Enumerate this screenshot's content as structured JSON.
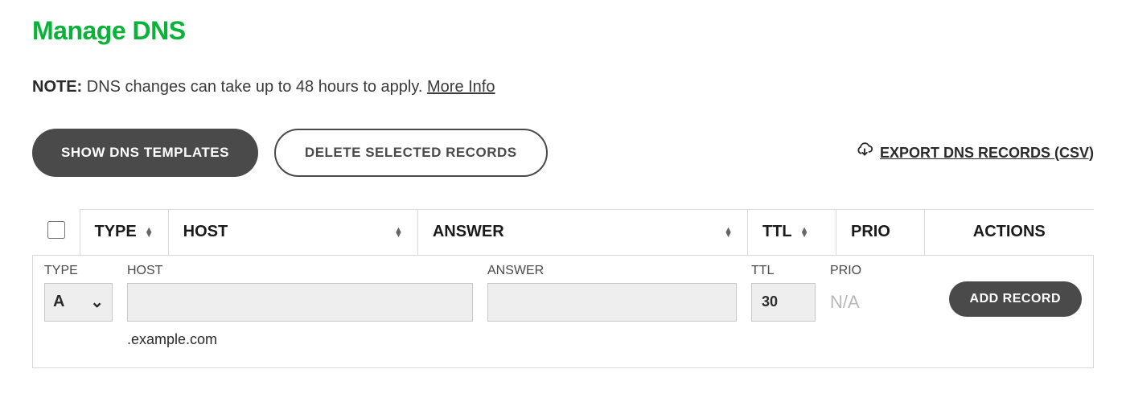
{
  "title": "Manage DNS",
  "note": {
    "label": "NOTE:",
    "text": " DNS changes can take up to 48 hours to apply. ",
    "link": "More Info"
  },
  "buttons": {
    "show_templates": "SHOW DNS TEMPLATES",
    "delete_selected": "DELETE SELECTED RECORDS",
    "export": "EXPORT DNS RECORDS (CSV)",
    "add_record": "ADD RECORD"
  },
  "columns": {
    "type": "TYPE",
    "host": "HOST",
    "answer": "ANSWER",
    "ttl": "TTL",
    "prio": "PRIO",
    "actions": "ACTIONS"
  },
  "entry": {
    "labels": {
      "type": "TYPE",
      "host": "HOST",
      "answer": "ANSWER",
      "ttl": "TTL",
      "prio": "PRIO"
    },
    "type_value": "A",
    "host_value": "",
    "host_suffix": ".example.com",
    "answer_value": "",
    "ttl_value": "30",
    "prio_display": "N/A"
  }
}
